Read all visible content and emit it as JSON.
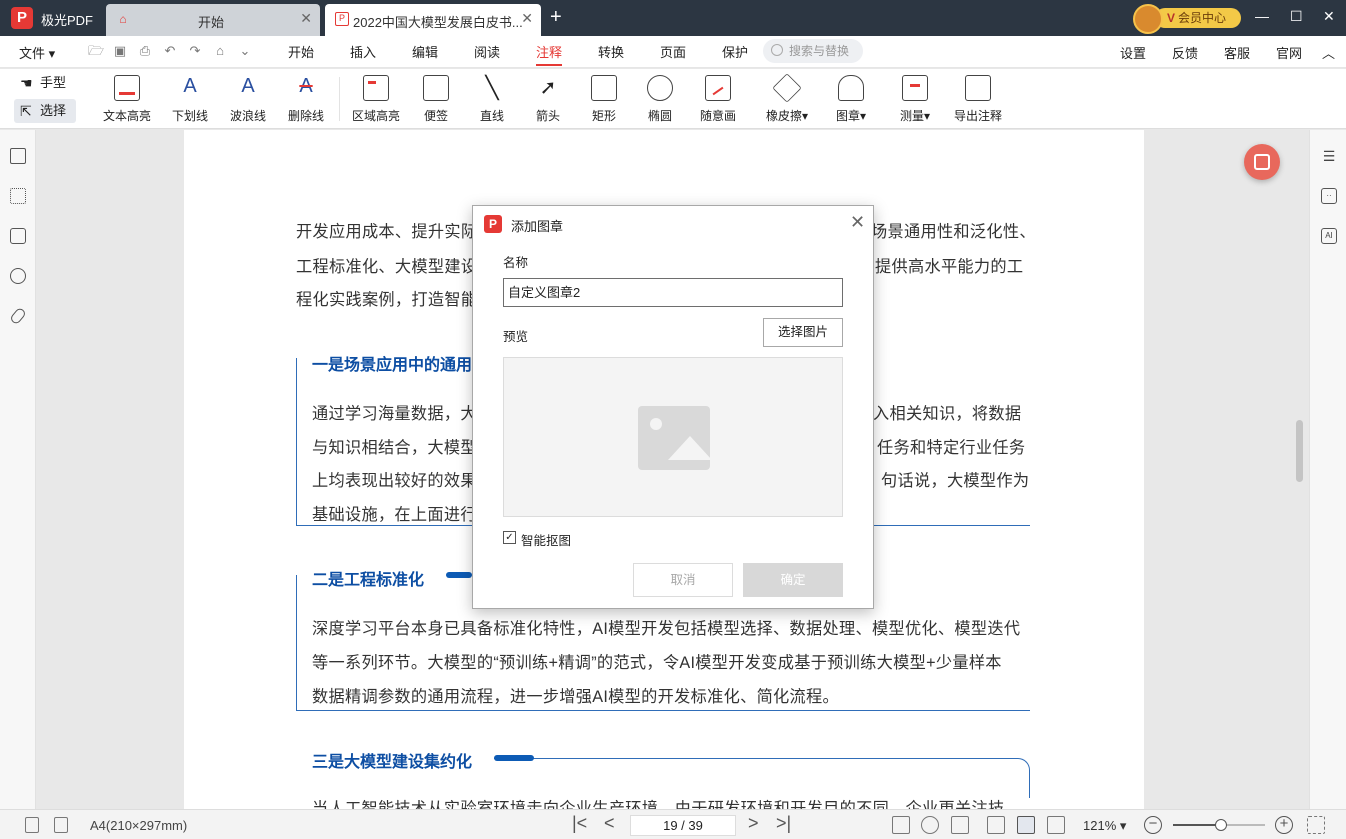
{
  "titlebar": {
    "app_name": "极光PDF",
    "app_logo": "P",
    "tabs": [
      {
        "label": "开始",
        "icon": "home-icon"
      },
      {
        "label": "2022中国大模型发展白皮书...",
        "icon": "pdf-file-icon"
      }
    ],
    "new_tab": "+",
    "member_center": "会员中心",
    "member_badge": "V"
  },
  "menubar": {
    "file": "文件 ▾",
    "tabs": [
      "开始",
      "插入",
      "编辑",
      "阅读",
      "注释",
      "转换",
      "页面",
      "保护"
    ],
    "active_tab": "注释",
    "search_placeholder": "搜索与替换",
    "right": [
      "设置",
      "反馈",
      "客服",
      "官网"
    ]
  },
  "toolbar": {
    "hand": "手型",
    "select": "选择",
    "tools": [
      "文本高亮",
      "下划线",
      "波浪线",
      "删除线",
      "区域高亮",
      "便签",
      "直线",
      "箭头",
      "矩形",
      "椭圆",
      "随意画",
      "橡皮擦",
      "图章",
      "测量",
      "导出注释"
    ]
  },
  "document": {
    "paragraphs": [
      "开发应用成本、提升实际",
      "工程标准化、大模型建设",
      "程化实践案例，打造智能",
      "场景通用性和泛化性、",
      "提供高水平能力的工",
      "通过学习海量数据，大",
      "与知识相结合，大模型",
      "上均表现出较好的效果",
      "基础设施，在上面进行",
      "入相关知识，将数据",
      "任务和特定行业任务",
      "句话说，大模型作为",
      "深度学习平台本身已具备标准化特性，AI模型开发包括模型选择、数据处理、模型优化、模型迭代",
      "等一系列环节。大模型的“预训练+精调”的范式，令AI模型开发变成基于预训练大模型+少量样本",
      "数据精调参数的通用流程，进一步增强AI模型的开发标准化、简化流程。",
      "当人工智能技术从实验室环境走向企业生产环境，由于研发环境和开发目的不同，企业更关注技"
    ],
    "headings": [
      "一是场景应用中的通用",
      "二是工程标准化",
      "三是大模型建设集约化"
    ]
  },
  "dialog": {
    "title": "添加图章",
    "name_label": "名称",
    "name_value": "自定义图章2",
    "preview_label": "预览",
    "choose_image": "选择图片",
    "smart_cutout": "智能抠图",
    "smart_cutout_checked": true,
    "cancel": "取消",
    "ok": "确定"
  },
  "statusbar": {
    "page_size": "A4(210×297mm)",
    "page_indicator": "19 / 39",
    "zoom": "121%",
    "zoom_fraction": 0.52
  }
}
